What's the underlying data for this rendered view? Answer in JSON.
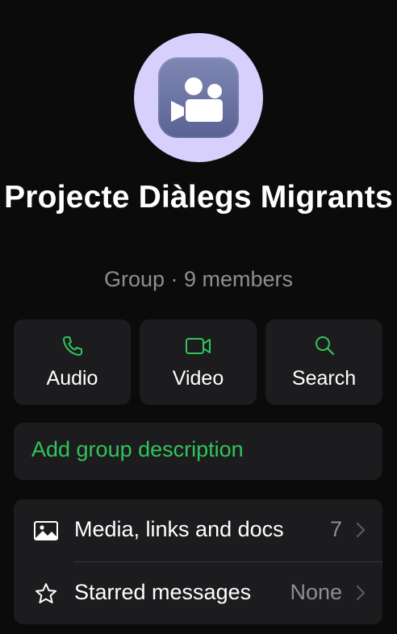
{
  "group": {
    "name": "Projecte Diàlegs Migrants",
    "subtitle": "Group · 9 members",
    "avatar_icon": "video-camera-people-icon",
    "avatar_bg": "#d7cffc"
  },
  "actions": [
    {
      "label": "Audio",
      "icon": "phone-icon"
    },
    {
      "label": "Video",
      "icon": "video-icon"
    },
    {
      "label": "Search",
      "icon": "search-icon"
    }
  ],
  "description": {
    "placeholder": "Add group description"
  },
  "rows": [
    {
      "label": "Media, links and docs",
      "value": "7",
      "icon": "image-icon"
    },
    {
      "label": "Starred messages",
      "value": "None",
      "icon": "star-icon"
    }
  ],
  "colors": {
    "background": "#0b0b0b",
    "card": "#1c1c1e",
    "accent_green": "#31c45d",
    "secondary_text": "#8e8e93"
  }
}
